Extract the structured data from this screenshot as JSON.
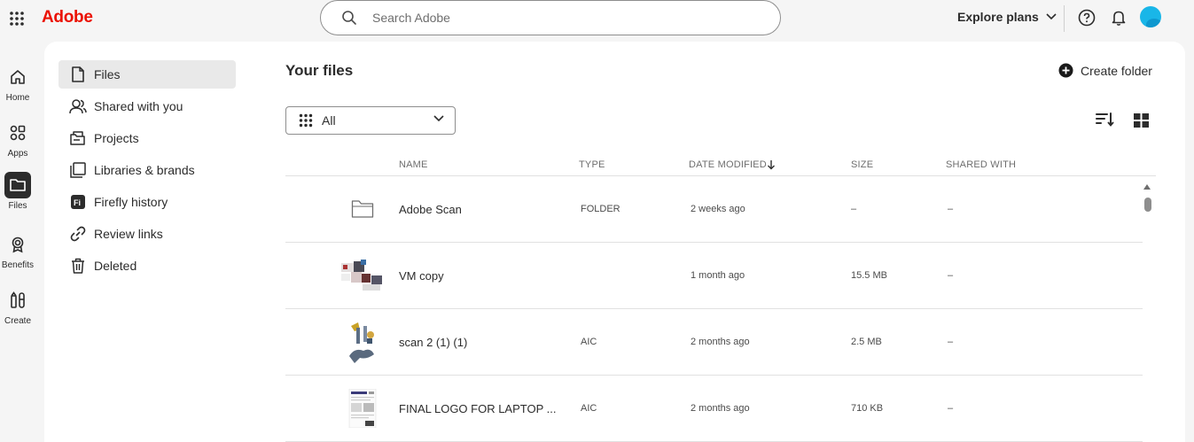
{
  "header": {
    "logo": "Adobe",
    "search_placeholder": "Search Adobe",
    "explore_label": "Explore plans"
  },
  "rail": [
    {
      "label": "Home",
      "icon": "home-icon"
    },
    {
      "label": "Apps",
      "icon": "apps-icon"
    },
    {
      "label": "Files",
      "icon": "folder-icon",
      "active": true
    },
    {
      "label": "Benefits",
      "icon": "award-icon"
    },
    {
      "label": "Create",
      "icon": "create-icon"
    }
  ],
  "nav": [
    {
      "label": "Files",
      "icon": "file-icon",
      "active": true
    },
    {
      "label": "Shared with you",
      "icon": "people-icon"
    },
    {
      "label": "Projects",
      "icon": "projects-icon"
    },
    {
      "label": "Libraries & brands",
      "icon": "libraries-icon"
    },
    {
      "label": "Firefly history",
      "icon": "firefly-icon"
    },
    {
      "label": "Review links",
      "icon": "link-icon"
    },
    {
      "label": "Deleted",
      "icon": "trash-icon"
    }
  ],
  "content": {
    "title": "Your files",
    "create_folder_label": "Create folder",
    "filter_value": "All"
  },
  "table": {
    "columns": [
      "NAME",
      "TYPE",
      "DATE MODIFIED",
      "SIZE",
      "SHARED WITH"
    ],
    "rows": [
      {
        "name": "Adobe Scan",
        "type": "FOLDER",
        "date": "2 weeks ago",
        "size": "–",
        "shared": "–",
        "thumb": "folder"
      },
      {
        "name": "VM copy",
        "type": "",
        "date": "1 month ago",
        "size": "15.5 MB",
        "shared": "–",
        "thumb": "collage"
      },
      {
        "name": "scan 2 (1) (1)",
        "type": "AIC",
        "date": "2 months ago",
        "size": "2.5 MB",
        "shared": "–",
        "thumb": "sketch"
      },
      {
        "name": "FINAL LOGO FOR LAPTOP ...",
        "type": "AIC",
        "date": "2 months ago",
        "size": "710 KB",
        "shared": "–",
        "thumb": "doc"
      }
    ]
  },
  "colors": {
    "brand": "#eb1000",
    "avatar": "#19b6e8"
  }
}
